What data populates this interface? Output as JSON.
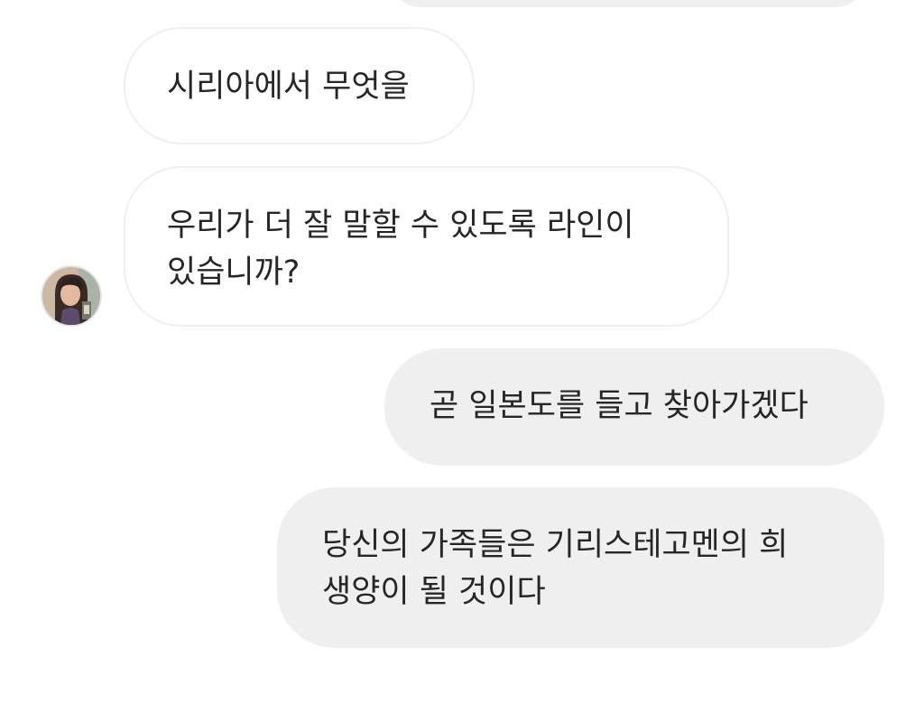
{
  "conversation": {
    "messages": [
      {
        "sender": "other",
        "text": "시리아에서 무엇을"
      },
      {
        "sender": "other",
        "text": "우리가 더 잘 말할 수 있도록 라인이\n있습니까?"
      },
      {
        "sender": "me",
        "text": "곧 일본도를 들고 찾아가겠다"
      },
      {
        "sender": "me",
        "text": "당신의 가족들은 기리스테고멘의 희\n생양이 될 것이다"
      }
    ]
  },
  "colors": {
    "background": "#ffffff",
    "sent_bubble": "#efefef",
    "received_border": "#efefef",
    "text": "#262626"
  },
  "icons": {
    "avatar": "user-avatar-photo"
  }
}
